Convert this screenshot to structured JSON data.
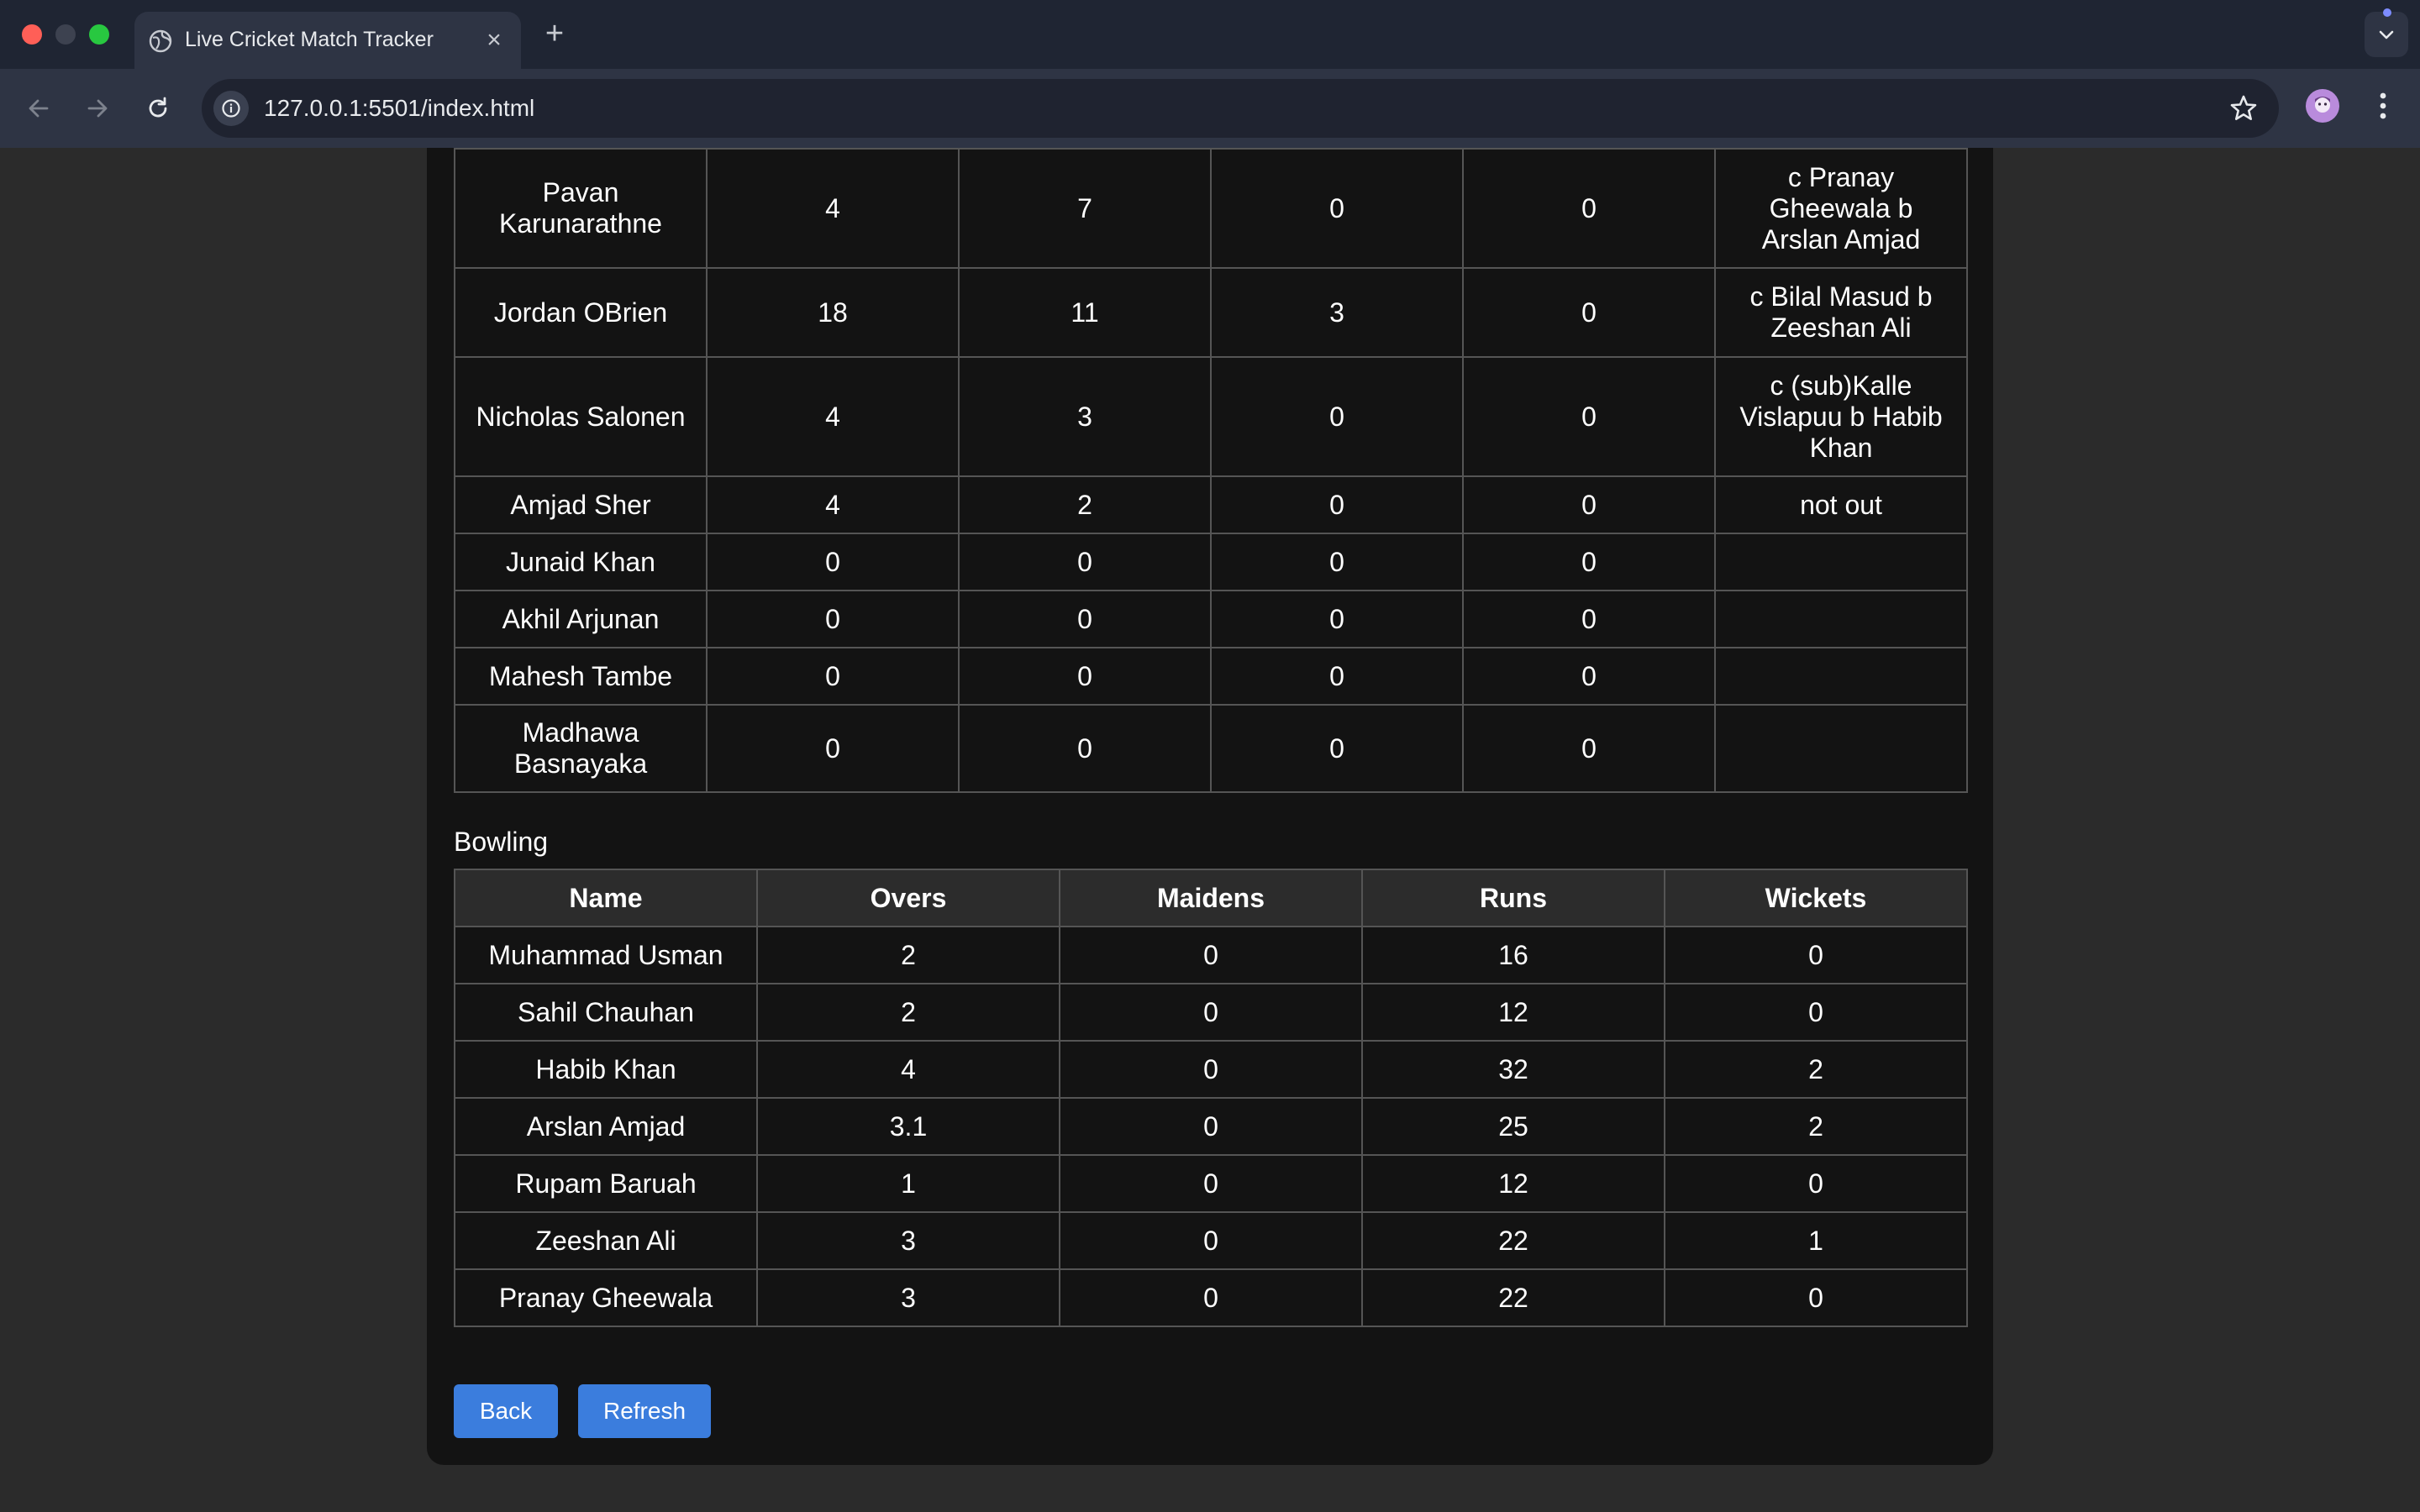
{
  "browser": {
    "tab_title": "Live Cricket Match Tracker",
    "url": "127.0.0.1:5501/index.html",
    "colors": {
      "tabbar": "#1f2533",
      "toolbar": "#2e3444",
      "close": "#ff5f57",
      "zoom": "#28c840"
    }
  },
  "batting": {
    "rows": [
      {
        "name": "Pavan Karunarathne",
        "runs": "4",
        "balls": "7",
        "fours": "0",
        "sixes": "0",
        "dismissal": "c Pranay Gheewala b Arslan Amjad"
      },
      {
        "name": "Jordan OBrien",
        "runs": "18",
        "balls": "11",
        "fours": "3",
        "sixes": "0",
        "dismissal": "c Bilal Masud b Zeeshan Ali"
      },
      {
        "name": "Nicholas Salonen",
        "runs": "4",
        "balls": "3",
        "fours": "0",
        "sixes": "0",
        "dismissal": "c (sub)Kalle Vislapuu b Habib Khan"
      },
      {
        "name": "Amjad Sher",
        "runs": "4",
        "balls": "2",
        "fours": "0",
        "sixes": "0",
        "dismissal": "not out"
      },
      {
        "name": "Junaid Khan",
        "runs": "0",
        "balls": "0",
        "fours": "0",
        "sixes": "0",
        "dismissal": ""
      },
      {
        "name": "Akhil Arjunan",
        "runs": "0",
        "balls": "0",
        "fours": "0",
        "sixes": "0",
        "dismissal": ""
      },
      {
        "name": "Mahesh Tambe",
        "runs": "0",
        "balls": "0",
        "fours": "0",
        "sixes": "0",
        "dismissal": ""
      },
      {
        "name": "Madhawa Basnayaka",
        "runs": "0",
        "balls": "0",
        "fours": "0",
        "sixes": "0",
        "dismissal": ""
      }
    ]
  },
  "bowling": {
    "title": "Bowling",
    "headers": {
      "name": "Name",
      "overs": "Overs",
      "maidens": "Maidens",
      "runs": "Runs",
      "wickets": "Wickets"
    },
    "rows": [
      {
        "name": "Muhammad Usman",
        "overs": "2",
        "maidens": "0",
        "runs": "16",
        "wickets": "0"
      },
      {
        "name": "Sahil Chauhan",
        "overs": "2",
        "maidens": "0",
        "runs": "12",
        "wickets": "0"
      },
      {
        "name": "Habib Khan",
        "overs": "4",
        "maidens": "0",
        "runs": "32",
        "wickets": "2"
      },
      {
        "name": "Arslan Amjad",
        "overs": "3.1",
        "maidens": "0",
        "runs": "25",
        "wickets": "2"
      },
      {
        "name": "Rupam Baruah",
        "overs": "1",
        "maidens": "0",
        "runs": "12",
        "wickets": "0"
      },
      {
        "name": "Zeeshan Ali",
        "overs": "3",
        "maidens": "0",
        "runs": "22",
        "wickets": "1"
      },
      {
        "name": "Pranay Gheewala",
        "overs": "3",
        "maidens": "0",
        "runs": "22",
        "wickets": "0"
      }
    ]
  },
  "actions": {
    "back_label": "Back",
    "refresh_label": "Refresh",
    "accent": "#3b7ddd"
  }
}
